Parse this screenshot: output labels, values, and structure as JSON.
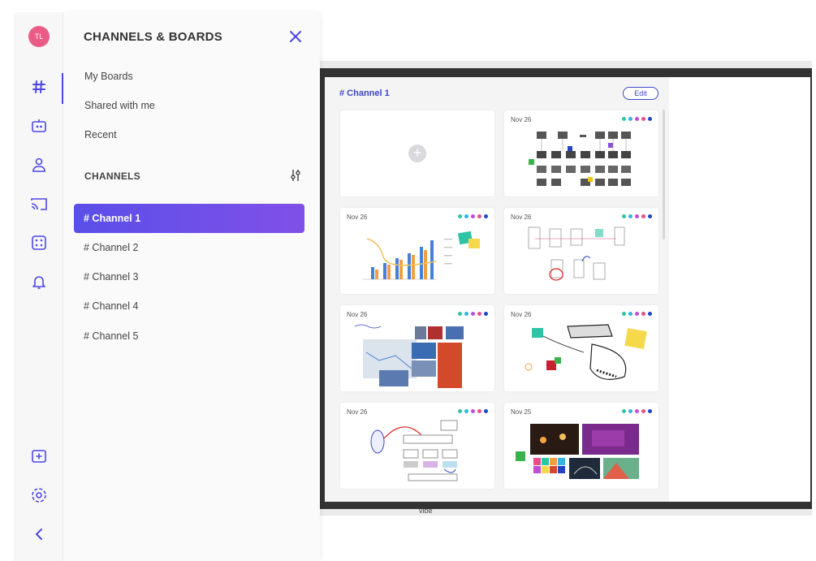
{
  "app": {
    "brand": "vibe"
  },
  "user": {
    "initials": "TL"
  },
  "rail": {
    "icons": [
      {
        "name": "channels-icon",
        "active": true
      },
      {
        "name": "scoreboard-icon"
      },
      {
        "name": "user-icon"
      },
      {
        "name": "cast-icon"
      },
      {
        "name": "apps-icon"
      },
      {
        "name": "bell-icon"
      }
    ],
    "bottom_icons": [
      {
        "name": "add-board-icon"
      },
      {
        "name": "settings-icon"
      },
      {
        "name": "collapse-icon"
      }
    ]
  },
  "sidebar": {
    "title": "CHANNELS & BOARDS",
    "nav": [
      "My Boards",
      "Shared with me",
      "Recent"
    ],
    "channels_label": "CHANNELS",
    "channels": [
      "# Channel 1",
      "# Channel 2",
      "# Channel 3",
      "# Channel 4",
      "# Channel 5"
    ],
    "active_channel": 0
  },
  "board_panel": {
    "header": "# Channel 1",
    "edit_label": "Edit",
    "dot_colors": [
      "#2ec4a6",
      "#36b3e0",
      "#c04fd6",
      "#e84f8a",
      "#2344c4"
    ],
    "cards": [
      {
        "date": "",
        "kind": "new"
      },
      {
        "date": "Nov 26",
        "kind": "flow"
      },
      {
        "date": "Nov 26",
        "kind": "chart"
      },
      {
        "date": "Nov 26",
        "kind": "wire"
      },
      {
        "date": "Nov 26",
        "kind": "photos"
      },
      {
        "date": "Nov 26",
        "kind": "sketch"
      },
      {
        "date": "Nov 26",
        "kind": "diagram"
      },
      {
        "date": "Nov 25",
        "kind": "gallery"
      }
    ]
  },
  "colors": {
    "accent": "#4f46e5",
    "avatar": "#ea5b86"
  }
}
